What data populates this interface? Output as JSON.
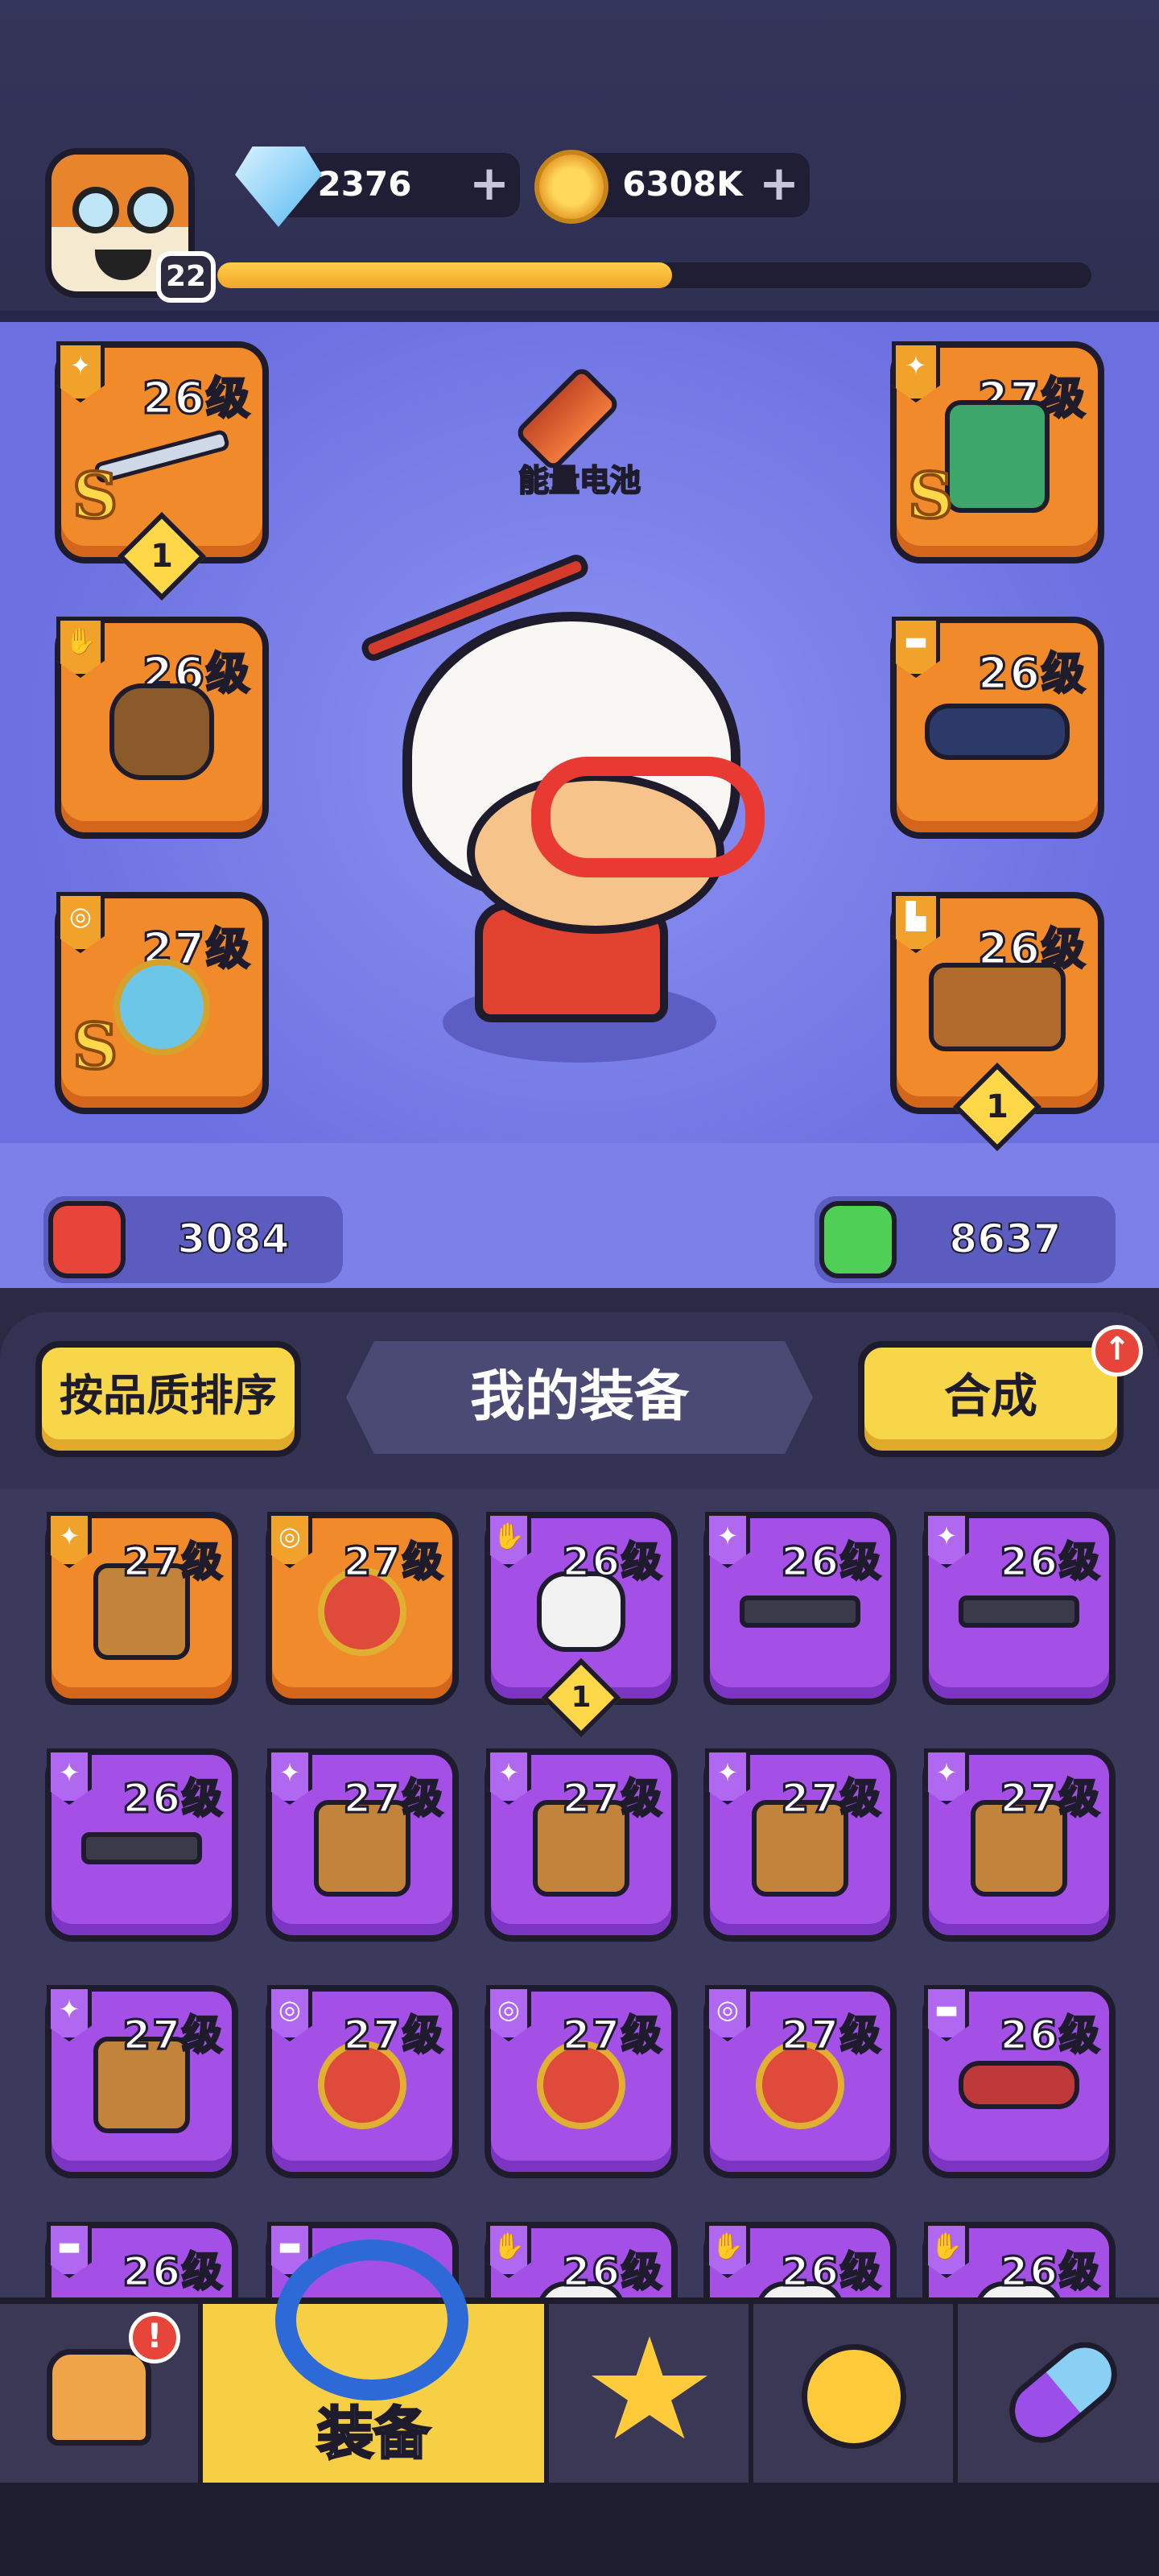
{
  "header": {
    "player_level": "22",
    "xp_progress": 0.52,
    "gems": "2376",
    "coins": "6308K",
    "plus_symbol": "+"
  },
  "hero_panel": {
    "battery_label": "能量电池",
    "slots": [
      {
        "id": "weapon",
        "level": "26级",
        "rank": "S",
        "count": "1",
        "type_icon": "gun-icon"
      },
      {
        "id": "armor",
        "level": "27级",
        "rank": "S",
        "count": null,
        "type_icon": "vest-icon"
      },
      {
        "id": "gloves",
        "level": "26级",
        "rank": null,
        "count": null,
        "type_icon": "glove-icon"
      },
      {
        "id": "belt",
        "level": "26级",
        "rank": null,
        "count": null,
        "type_icon": "belt-icon"
      },
      {
        "id": "ring",
        "level": "27级",
        "rank": "S",
        "count": null,
        "type_icon": "ring-icon"
      },
      {
        "id": "boots",
        "level": "26级",
        "rank": null,
        "count": "1",
        "type_icon": "boot-icon"
      }
    ],
    "attack": "3084",
    "health": "8637"
  },
  "inventory": {
    "sort_button": "按品质排序",
    "title": "我的装备",
    "merge_button": "合成",
    "merge_badge": "↑",
    "items": [
      {
        "level": "27级",
        "quality": "orange",
        "type_icon": "vest-icon",
        "count": null
      },
      {
        "level": "27级",
        "quality": "orange",
        "type_icon": "ring-icon",
        "count": null
      },
      {
        "level": "26级",
        "quality": "purple",
        "type_icon": "glove-icon",
        "count": "1"
      },
      {
        "level": "26级",
        "quality": "purple",
        "type_icon": "gun-icon",
        "count": null
      },
      {
        "level": "26级",
        "quality": "purple",
        "type_icon": "gun-icon",
        "count": null
      },
      {
        "level": "26级",
        "quality": "purple",
        "type_icon": "gun-icon",
        "count": null
      },
      {
        "level": "27级",
        "quality": "purple",
        "type_icon": "vest-icon",
        "count": null
      },
      {
        "level": "27级",
        "quality": "purple",
        "type_icon": "vest-icon",
        "count": null
      },
      {
        "level": "27级",
        "quality": "purple",
        "type_icon": "vest-icon",
        "count": null
      },
      {
        "level": "27级",
        "quality": "purple",
        "type_icon": "vest-icon",
        "count": null
      },
      {
        "level": "27级",
        "quality": "purple",
        "type_icon": "vest-icon",
        "count": null
      },
      {
        "level": "27级",
        "quality": "purple",
        "type_icon": "ring-icon",
        "count": null
      },
      {
        "level": "27级",
        "quality": "purple",
        "type_icon": "ring-icon",
        "count": null
      },
      {
        "level": "27级",
        "quality": "purple",
        "type_icon": "ring-icon",
        "count": null
      },
      {
        "level": "26级",
        "quality": "purple",
        "type_icon": "belt-icon",
        "count": null
      },
      {
        "level": "26级",
        "quality": "purple",
        "type_icon": "belt-icon",
        "count": null
      },
      {
        "level": "",
        "quality": "purple",
        "type_icon": "belt-icon",
        "count": null
      },
      {
        "level": "26级",
        "quality": "purple",
        "type_icon": "glove-icon",
        "count": null
      },
      {
        "level": "26级",
        "quality": "purple",
        "type_icon": "glove-icon",
        "count": null
      },
      {
        "level": "26级",
        "quality": "purple",
        "type_icon": "glove-icon",
        "count": null
      }
    ]
  },
  "nav": {
    "alert": "!",
    "tabs": [
      {
        "id": "home",
        "label": "",
        "icon": "house-icon"
      },
      {
        "id": "equipment",
        "label": "装备",
        "icon": "ring-equip-icon"
      },
      {
        "id": "talent",
        "label": "",
        "icon": "star-icon"
      },
      {
        "id": "pet",
        "label": "",
        "icon": "chick-icon"
      },
      {
        "id": "shop",
        "label": "",
        "icon": "capsule-icon"
      }
    ]
  },
  "colors": {
    "orange_quality": "#f08a2b",
    "purple_quality": "#a450e6",
    "accent_yellow": "#f7d64a",
    "attack_red": "#e8453a",
    "health_green": "#4fcf55"
  }
}
